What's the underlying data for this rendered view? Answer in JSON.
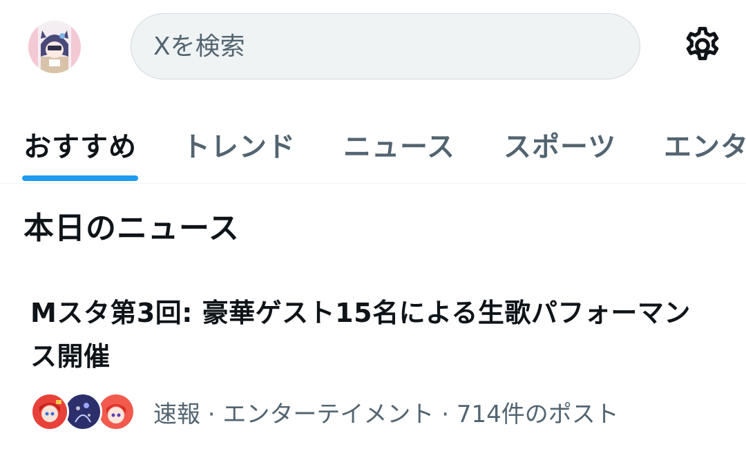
{
  "header": {
    "search_placeholder": "Xを検索"
  },
  "tabs": [
    {
      "label": "おすすめ",
      "active": true
    },
    {
      "label": "トレンド",
      "active": false
    },
    {
      "label": "ニュース",
      "active": false
    },
    {
      "label": "スポーツ",
      "active": false
    },
    {
      "label": "エンタ",
      "active": false
    }
  ],
  "section": {
    "title": "本日のニュース"
  },
  "news": {
    "title": "Mスタ第3回: 豪華ゲスト15名による生歌パフォーマンス開催",
    "meta": "速報 · エンターテイメント · 714件のポスト",
    "avatar_icons": [
      "avatar-red-hair",
      "avatar-dark-blue",
      "avatar-red-hair-2"
    ]
  },
  "colors": {
    "accent": "#1d9bf0",
    "text_primary": "#0f1419",
    "text_secondary": "#536471",
    "search_bg": "#eff3f4"
  }
}
